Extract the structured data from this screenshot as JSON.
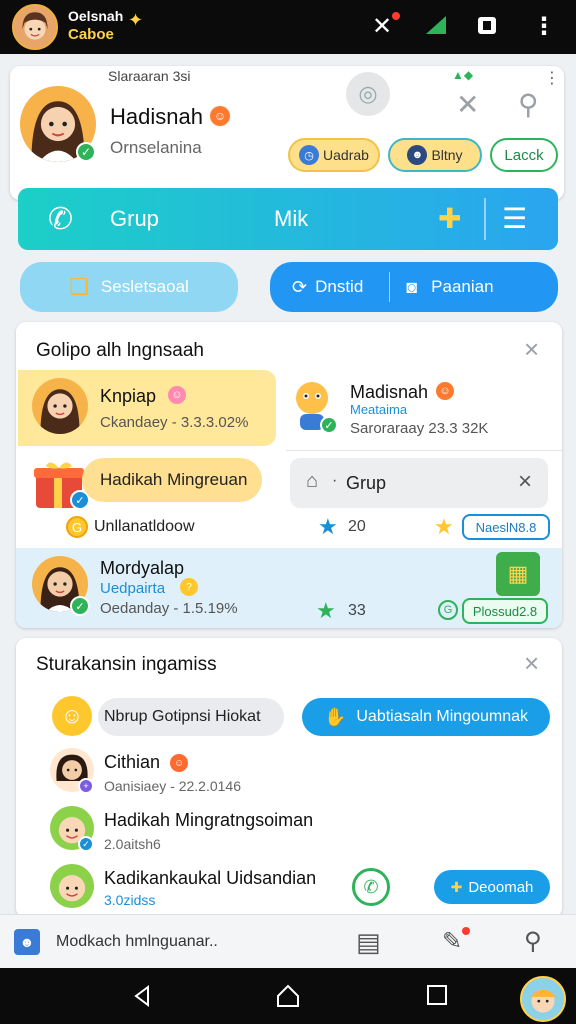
{
  "status_bar": {
    "app_line1": "Oelsnah",
    "app_line2": "Caboe"
  },
  "profile": {
    "small_header": "Slaraaran 3si",
    "name": "Hadisnah",
    "subtitle": "Ornselanina",
    "chips": [
      "Uadrab",
      "Bltny",
      "Lacck"
    ]
  },
  "banner": {
    "left": "Grup",
    "mid": "Mik"
  },
  "action_row": {
    "left": "Sesletsaoal",
    "mid": "Dnstid",
    "right": "Paanian"
  },
  "groups_card": {
    "title": "Golipo alh lngnsaah",
    "items": [
      {
        "name": "Knpiap",
        "meta": "Ckandaey - 3.3.3.02%"
      },
      {
        "name": "Madisnah",
        "sub": "Meataima",
        "meta": "Saroraraay  23.3 32K"
      },
      {
        "name": "Hadikah Mingreuan"
      },
      {
        "name": "Grup"
      },
      {
        "name": "Unllanatldoow",
        "count": "20",
        "badge": "NaeslN8.8"
      },
      {
        "name": "Mordyalap",
        "sub": "Uedpairta",
        "meta": "Oedanday - 1.5.19%",
        "count": "33",
        "badge": "Plossud2.8"
      }
    ]
  },
  "suggest_card": {
    "title": "Sturakansin ingamiss",
    "chip_left": "Nbrup Gotipnsi Hiokat",
    "chip_right": "Uabtiasaln Mingoumnak",
    "items": [
      {
        "name": "Cithian",
        "meta": "Oanisiaey - 22.2.0146"
      },
      {
        "name": "Hadikah Mingratngsoiman",
        "meta": "2.0aitsh6"
      },
      {
        "name": "Kadikankaukal Uidsandian",
        "meta": "3.0zidss"
      }
    ],
    "action_button": "Deoomah"
  },
  "bottom_bar": {
    "text": "Modkach hmlnguanar.."
  },
  "colors": {
    "accent": "#1a9ee8",
    "teal": "#1cc9c9",
    "yellow": "#ffe79a",
    "green": "#2eb35b",
    "red": "#ff5252"
  }
}
